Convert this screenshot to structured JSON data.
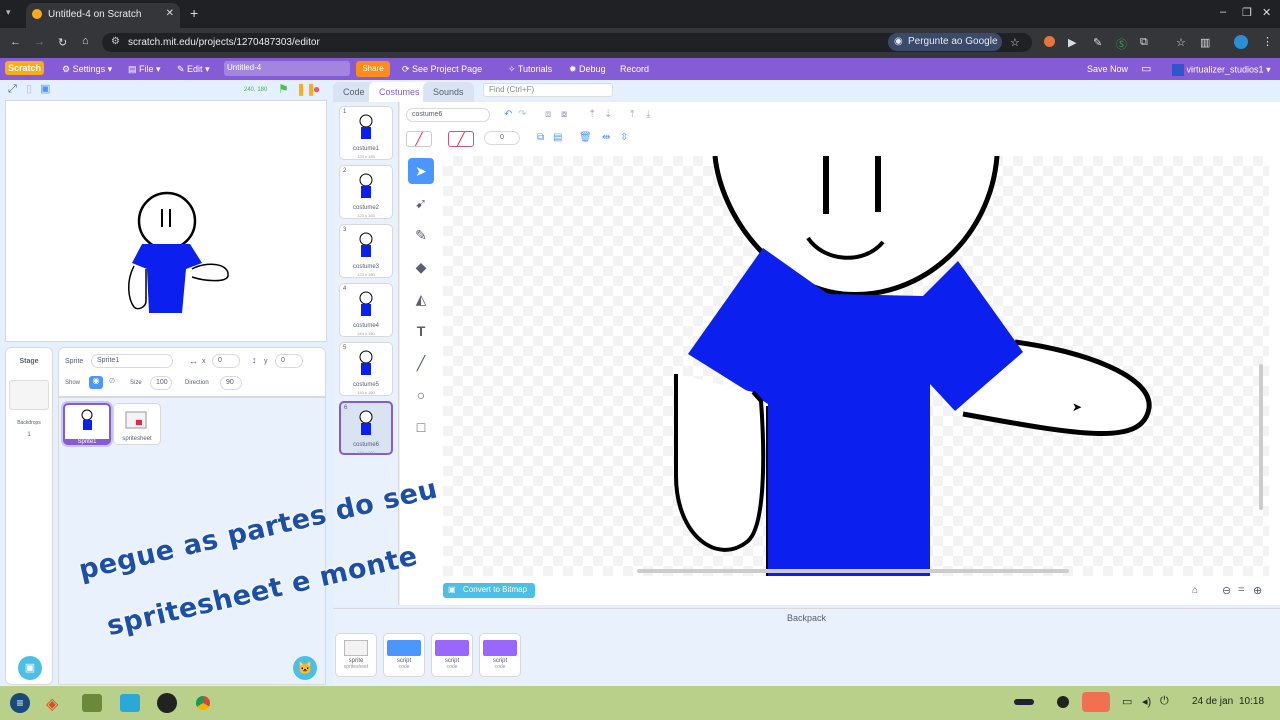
{
  "browser": {
    "tab_title": "Untitled-4 on Scratch",
    "url": "scratch.mit.edu/projects/1270487303/editor",
    "google_chip": "Pergunte ao Google"
  },
  "menubar": {
    "logo": "Scratch",
    "settings": "Settings",
    "file": "File",
    "edit": "Edit",
    "project_title": "Untitled-4",
    "share": "Share",
    "see_project_page": "See Project Page",
    "tutorials": "Tutorials",
    "debug": "Debug",
    "record": "Record",
    "save_now": "Save Now",
    "username": "virtualizer_studios1"
  },
  "stage_header": {
    "coords": "240, 180"
  },
  "sprite_info": {
    "sprite_label": "Sprite",
    "sprite_name": "Sprite1",
    "x_label": "x",
    "x_value": "0",
    "y_label": "y",
    "y_value": "0",
    "show_label": "Show",
    "size_label": "Size",
    "size_value": "100",
    "direction_label": "Direction",
    "direction_value": "90"
  },
  "stage_target": {
    "label": "Stage",
    "backdrops_label": "Backdrops",
    "backdrops_count": "1"
  },
  "sprites": [
    {
      "name": "Sprite1",
      "selected": true
    },
    {
      "name": "spritesheet",
      "selected": false
    }
  ],
  "editor_tabs": {
    "code": "Code",
    "costumes": "Costumes",
    "sounds": "Sounds",
    "find": "Find (Ctrl+F)"
  },
  "costumes": [
    {
      "num": "1",
      "name": "costume1",
      "dims": "123 x 183"
    },
    {
      "num": "2",
      "name": "costume2",
      "dims": "123 x 183"
    },
    {
      "num": "3",
      "name": "costume3",
      "dims": "123 x 180"
    },
    {
      "num": "4",
      "name": "costume4",
      "dims": "144 x 180"
    },
    {
      "num": "5",
      "name": "costume5",
      "dims": "130 x 160"
    },
    {
      "num": "6",
      "name": "costume6",
      "dims": "130 x 160"
    }
  ],
  "paint_editor": {
    "costume_name": "costume6",
    "outline_width": "0",
    "convert_button": "Convert to Bitmap"
  },
  "backpack": {
    "label": "Backpack",
    "items": [
      {
        "name": "sprite",
        "sub": "spritesheet"
      },
      {
        "name": "script",
        "sub": "code"
      },
      {
        "name": "script",
        "sub": "code"
      },
      {
        "name": "script",
        "sub": "code"
      }
    ]
  },
  "overlay_caption": {
    "line1": "pegue as partes do seu",
    "line2": "spritesheet e monte"
  },
  "taskbar": {
    "date": "24 de jan",
    "time": "10:18"
  },
  "colors": {
    "scratch_purple": "#855cd6",
    "shirt_blue": "#0b1fef",
    "share_orange": "#ff8c1a",
    "select_blue": "#4c97ff"
  }
}
